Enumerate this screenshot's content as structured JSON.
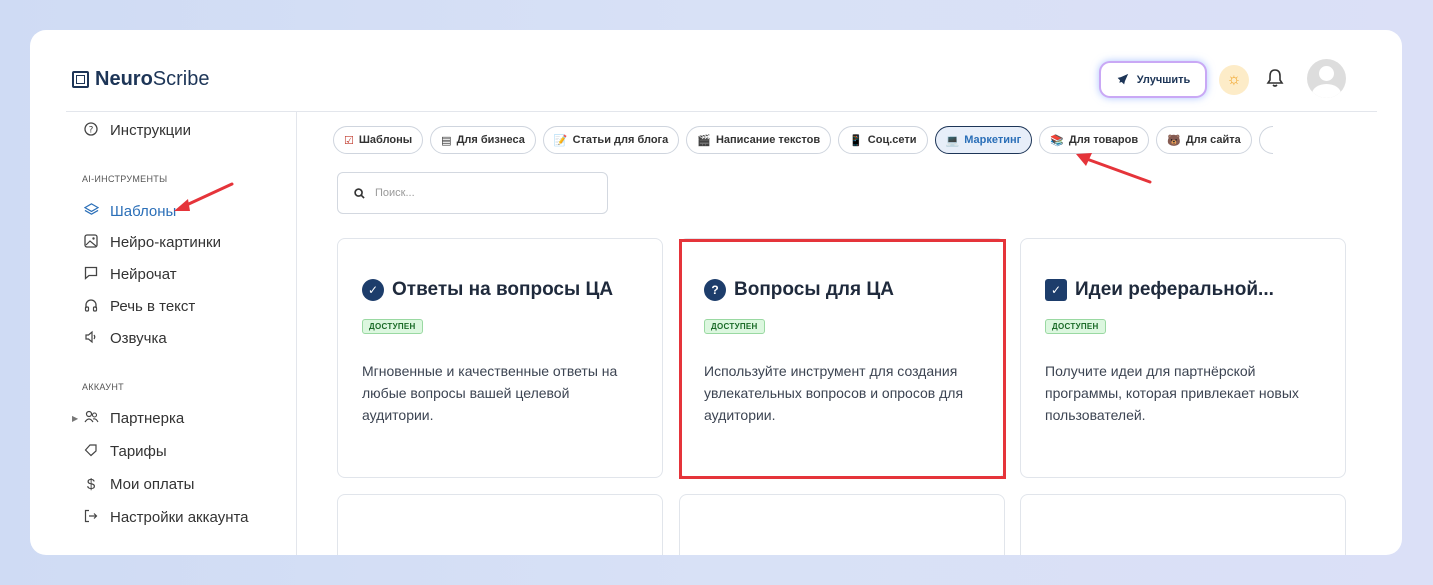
{
  "app": {
    "logo_bold": "Neuro",
    "logo_light": "Scribe"
  },
  "header": {
    "upgrade_label": "Улучшить"
  },
  "sidebar": {
    "top_item": "Инструкции",
    "section_ai": "AI-ИНСТРУМЕНТЫ",
    "ai_items": [
      {
        "label": "Шаблоны",
        "icon": "layers-icon"
      },
      {
        "label": "Нейро-картинки",
        "icon": "image-icon"
      },
      {
        "label": "Нейрочат",
        "icon": "chat-icon"
      },
      {
        "label": "Речь в текст",
        "icon": "headphones-icon"
      },
      {
        "label": "Озвучка",
        "icon": "speaker-icon"
      }
    ],
    "section_account": "АККАУНТ",
    "account_items": [
      {
        "label": "Партнерка",
        "icon": "users-icon"
      },
      {
        "label": "Тарифы",
        "icon": "tag-icon"
      },
      {
        "label": "Мои оплаты",
        "icon": "dollar-icon"
      },
      {
        "label": "Настройки аккаунта",
        "icon": "logout-icon"
      }
    ]
  },
  "tabs": [
    {
      "label": "Шаблоны",
      "emoji": "☑"
    },
    {
      "label": "Для бизнеса",
      "emoji": "▤"
    },
    {
      "label": "Статьи для блога",
      "emoji": "📝"
    },
    {
      "label": "Написание текстов",
      "emoji": "🎬"
    },
    {
      "label": "Соц.сети",
      "emoji": "📱"
    },
    {
      "label": "Маркетинг",
      "emoji": "💻"
    },
    {
      "label": "Для товаров",
      "emoji": "📚"
    },
    {
      "label": "Для сайта",
      "emoji": "🐻"
    }
  ],
  "active_tab": "Маркетинг",
  "search": {
    "placeholder": "Поиск..."
  },
  "cards": [
    {
      "title": "Ответы на вопросы ЦА",
      "badge": "ДОСТУПЕН",
      "desc": "Мгновенные и качественные ответы на любые вопросы вашей целевой аудитории.",
      "icon": "check-circle-icon"
    },
    {
      "title": "Вопросы для ЦА",
      "badge": "ДОСТУПЕН",
      "desc": "Используйте инструмент для создания увлекательных вопросов и опросов для аудитории.",
      "icon": "question-circle-icon"
    },
    {
      "title": "Идеи реферальной...",
      "badge": "ДОСТУПЕН",
      "desc": "Получите идеи для партнёрской программы, которая привлекает новых пользователей.",
      "icon": "check-square-icon"
    }
  ],
  "colors": {
    "accent": "#2b6fb8",
    "highlight": "#e5343a",
    "badge_bg": "#dcf7df"
  }
}
